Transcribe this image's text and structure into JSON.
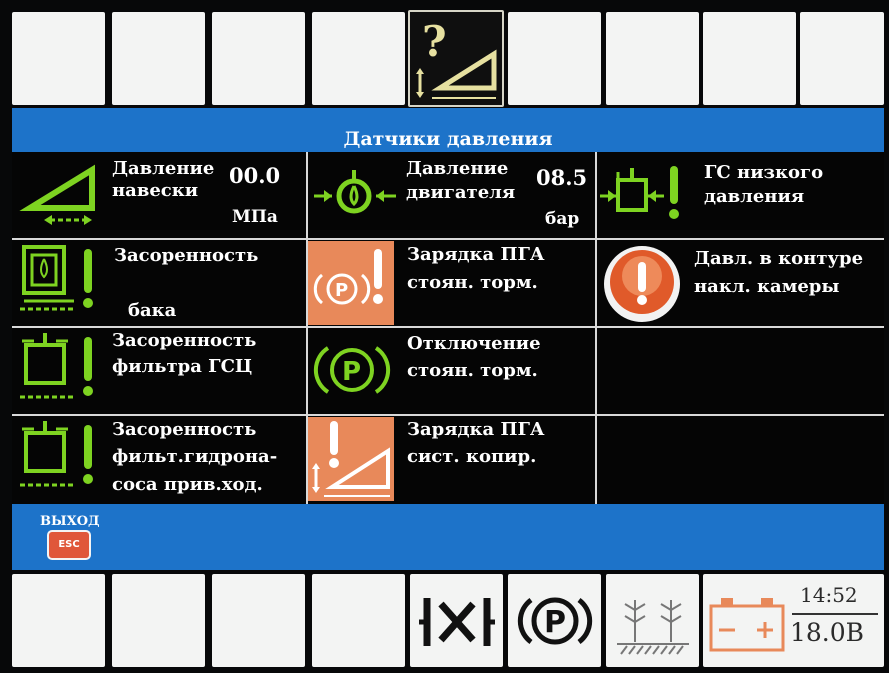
{
  "screen": {
    "title": "Датчики давления",
    "exit_label": "ВЫХОД",
    "esc_label": "ESC"
  },
  "cells": {
    "hitch_pressure": {
      "label_line1": "Давление",
      "label_line2": "навески",
      "value": "00.0",
      "unit": "МПа"
    },
    "engine_pressure": {
      "label_line1": "Давление",
      "label_line2": "двигателя",
      "value": "08.5",
      "unit": "бар"
    },
    "low_pressure_hs": {
      "label_line1": "ГС низкого",
      "label_line2": "давления"
    },
    "tank_clogging": {
      "label_line1": "Засоренность",
      "label_line2": "бака"
    },
    "parking_brake_accum": {
      "label_line1": "Зарядка ПГА",
      "label_line2": "стоян. торм."
    },
    "tilt_chamber_pressure": {
      "label_line1": "Давл. в контуре",
      "label_line2": "накл. камеры"
    },
    "gsc_filter_clogging": {
      "label_line1": "Засоренность",
      "label_line2": "фильтра ГСЦ"
    },
    "parking_brake_off": {
      "label_line1": "Отключение",
      "label_line2": "стоян. торм."
    },
    "drive_pump_filter_clogging": {
      "label_line1": "Засоренность",
      "label_line2": "фильт.гидрона-",
      "label_line3": "соса прив.ход."
    },
    "copy_system_accum": {
      "label_line1": "Зарядка ПГА",
      "label_line2": "сист. копир."
    }
  },
  "status": {
    "time": "14:52",
    "voltage": "18.0В"
  },
  "icons": {
    "top_active": "help-hitch-icon",
    "bottom": [
      "differential-lock-icon",
      "parking-brake-icon",
      "crop-row-icon",
      "battery-icon"
    ]
  },
  "colors": {
    "background": "#070809",
    "blue": "#1d73c9",
    "icon_green": "#7ed321",
    "warning_orange": "#e8895a",
    "esc_red": "#e0573a"
  }
}
